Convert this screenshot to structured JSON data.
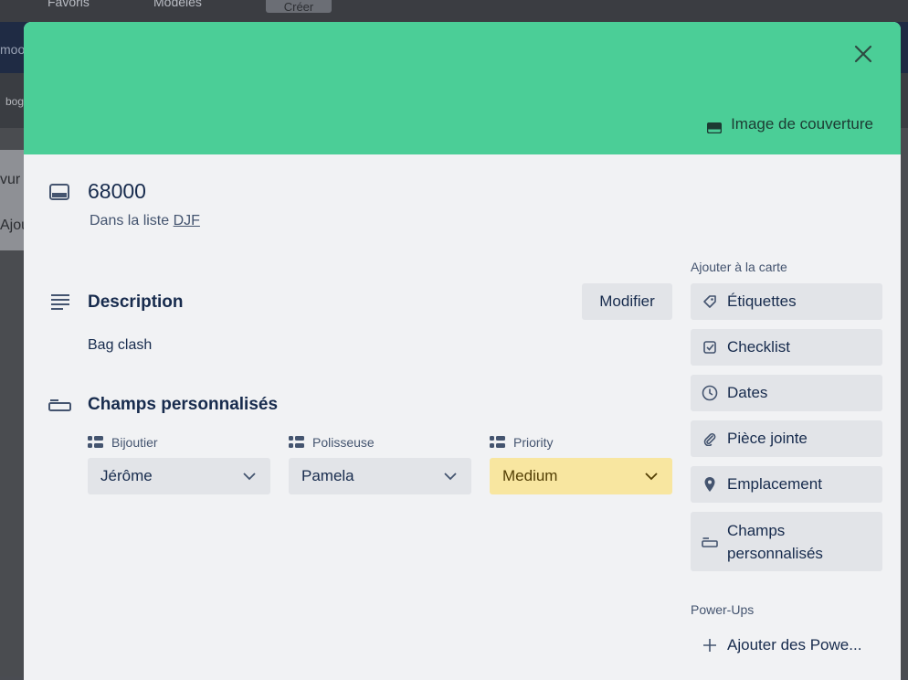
{
  "background": {
    "top_tabs": [
      "Favoris",
      "Modèles"
    ],
    "top_button": "Créer",
    "bar2_left": "moo",
    "bar3_left": "bogo",
    "col_texts": [
      "vur",
      "Ajou"
    ]
  },
  "cover": {
    "color": "#4bce97",
    "cover_image_label": "Image de couverture"
  },
  "card": {
    "title": "68000",
    "in_list_prefix": "Dans la liste",
    "list_name": "DJF"
  },
  "description": {
    "heading": "Description",
    "modify_label": "Modifier",
    "text": "Bag clash"
  },
  "custom_fields": {
    "heading": "Champs personnalisés",
    "fields": [
      {
        "label": "Bijoutier",
        "value": "Jérôme"
      },
      {
        "label": "Polisseuse",
        "value": "Pamela"
      },
      {
        "label": "Priority",
        "value": "Medium",
        "color": "#f8e6a0"
      }
    ]
  },
  "sidebar": {
    "add_heading": "Ajouter à la carte",
    "items": [
      {
        "label": "Étiquettes",
        "icon": "label-icon"
      },
      {
        "label": "Checklist",
        "icon": "checklist-icon"
      },
      {
        "label": "Dates",
        "icon": "clock-icon"
      },
      {
        "label": "Pièce jointe",
        "icon": "paperclip-icon"
      },
      {
        "label": "Emplacement",
        "icon": "location-pin-icon"
      },
      {
        "label_line1": "Champs",
        "label_line2": "personnalisés",
        "icon": "custom-fields-icon"
      }
    ],
    "powerups_heading": "Power-Ups",
    "add_powerups_label": "Ajouter des Powe..."
  }
}
